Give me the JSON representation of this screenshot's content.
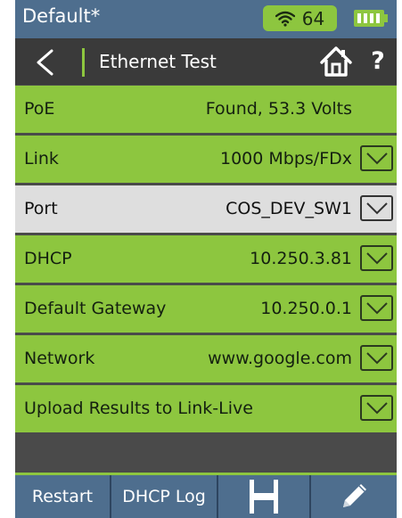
{
  "status": {
    "profile": "Default*",
    "wifi_signal": "64",
    "wifi_icon": "wifi-icon",
    "battery_icon": "battery-full-icon"
  },
  "header": {
    "title": "Ethernet Test",
    "help": "?"
  },
  "rows": [
    {
      "label": "PoE",
      "value": "Found, 53.3 Volts"
    },
    {
      "label": "Link",
      "value": "1000 Mbps/FDx"
    },
    {
      "label": "Port",
      "value": "COS_DEV_SW1"
    },
    {
      "label": "DHCP",
      "value": "10.250.3.81"
    },
    {
      "label": "Default Gateway",
      "value": "10.250.0.1"
    },
    {
      "label": "Network",
      "value": "www.google.com"
    },
    {
      "label": "Upload Results to Link-Live",
      "value": ""
    }
  ],
  "toolbar": {
    "restart": "Restart",
    "dhcp_log": "DHCP Log"
  },
  "colors": {
    "accent_green": "#8dc63f",
    "bar_blue": "#4e6e8e",
    "header_dark": "#3a3a3a",
    "selected_row": "#dedede"
  }
}
